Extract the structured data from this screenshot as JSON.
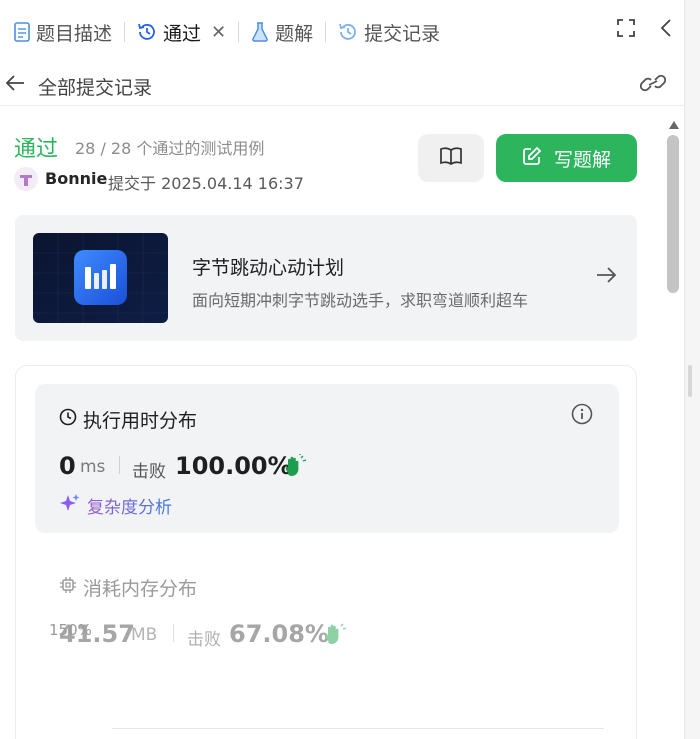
{
  "tabs": [
    {
      "label": "题目描述",
      "icon": "doc-icon"
    },
    {
      "label": "通过",
      "icon": "history-icon",
      "active": true
    },
    {
      "label": "题解",
      "icon": "flask-icon"
    },
    {
      "label": "提交记录",
      "icon": "history-icon"
    }
  ],
  "subbar": {
    "title": "全部提交记录"
  },
  "result": {
    "status": "通过",
    "cases": "28 / 28 个通过的测试用例",
    "user": "Bonnie",
    "submitted": "提交于 2025.04.14 16:37"
  },
  "buttons": {
    "solve_label": "写题解"
  },
  "promo": {
    "title": "字节跳动心动计划",
    "subtitle": "面向短期冲刺字节跳动选手，求职弯道顺利超车"
  },
  "runtime": {
    "title": "执行用时分布",
    "value": "0",
    "unit": "ms",
    "beat_label": "击败",
    "percent": "100.00%",
    "complexity_label": "复杂度分析"
  },
  "memory": {
    "title": "消耗内存分布",
    "value": "41.57",
    "unit": "MB",
    "beat_label": "击败",
    "percent": "67.08%"
  },
  "chart": {
    "y_tick": "150%"
  },
  "colors": {
    "accent_green": "#2db55d",
    "blue_icon": "#3b82f6"
  }
}
